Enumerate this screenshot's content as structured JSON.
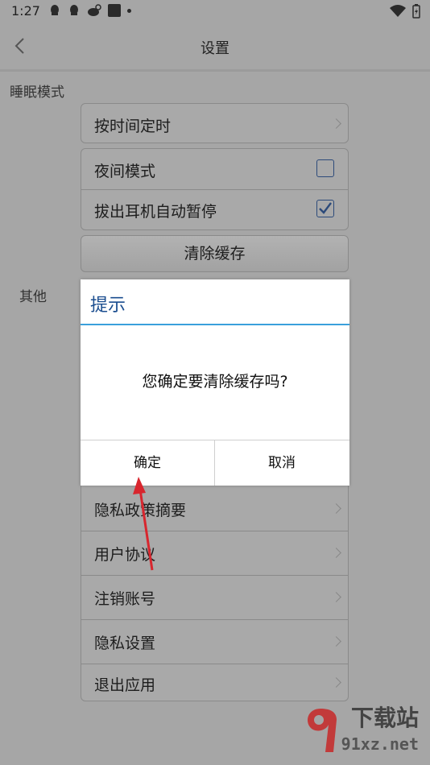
{
  "status_bar": {
    "time": "1:27"
  },
  "header": {
    "title": "设置"
  },
  "sections": {
    "sleep": "睡眠模式",
    "other": "其他"
  },
  "sleep_items": {
    "timer": "按时间定时",
    "night_mode": "夜间模式",
    "night_mode_checked": false,
    "pause_on_unplug": "拔出耳机自动暂停",
    "pause_on_unplug_checked": true
  },
  "clear_cache_label": "清除缓存",
  "other_items": [
    "隐私政策摘要",
    "用户协议",
    "注销账号",
    "隐私设置",
    "退出应用"
  ],
  "dialog": {
    "title": "提示",
    "message": "您确定要清除缓存吗?",
    "confirm": "确定",
    "cancel": "取消"
  },
  "watermark": {
    "text": "下载站",
    "site": "91xz.net"
  },
  "colors": {
    "accent": "#3aa0dc",
    "dialog_title": "#1a4d8f",
    "overlay_bg": "#a6a6a6"
  }
}
